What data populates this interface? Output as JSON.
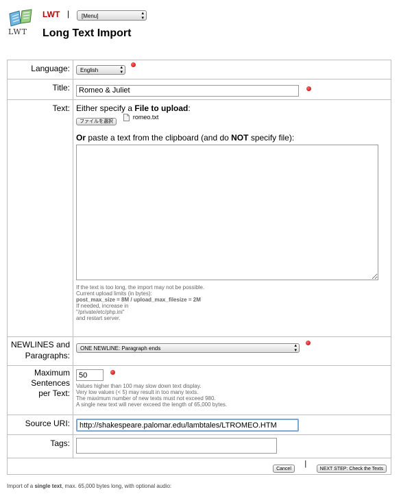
{
  "header": {
    "logo_text": "LWT",
    "brand_label": "LWT",
    "separator": "|",
    "menu_value": "[Menu]",
    "page_title": "Long Text Import"
  },
  "form": {
    "language": {
      "label": "Language:",
      "value": "English"
    },
    "title": {
      "label": "Title:",
      "value": "Romeo & Juliet"
    },
    "text": {
      "label": "Text:",
      "either": "Either specify a ",
      "file_bold": "File to upload",
      "colon": ":",
      "file_button": "ファイルを選択",
      "file_name": "romeo.txt",
      "or_bold": "Or",
      "paste_text": " paste a text from the clipboard (and do ",
      "not_bold": "NOT",
      "specify_text": " specify file):",
      "textarea_value": "",
      "notes": [
        "If the text is too long, the import may not be possible.",
        "Current upload limits (in bytes):",
        "post_max_size = 8M / upload_max_filesize = 2M",
        "If needed, increase in",
        "\"/private/etc/php.ini\"",
        "and restart server."
      ]
    },
    "newlines": {
      "label_line1": "NEWLINES and",
      "label_line2": "Paragraphs:",
      "value": "ONE NEWLINE: Paragraph ends"
    },
    "max_sentences": {
      "label_line1": "Maximum",
      "label_line2": "Sentences",
      "label_line3": "per Text:",
      "value": "50",
      "notes": [
        "Values higher than 100 may slow down text display.",
        "Very low values (< 5) may result in too many texts.",
        "The maximum number of new texts must not exceed 980.",
        "A single new text will never exceed the length of 65,000 bytes."
      ]
    },
    "source_uri": {
      "label": "Source URI:",
      "value": "http://shakespeare.palomar.edu/lambtales/LTROMEO.HTM"
    },
    "tags": {
      "label": "Tags:",
      "value": ""
    },
    "buttons": {
      "cancel": "Cancel",
      "separator": "|",
      "next": "NEXT STEP: Check the Texts"
    }
  },
  "footer": {
    "prefix": "Import of a ",
    "bold": "single text",
    "suffix": ", max. 65,000 bytes long, with optional audio:"
  },
  "colors": {
    "brand": "#c00000",
    "required_dot": "#cc0000",
    "border": "#bdbdbd"
  }
}
